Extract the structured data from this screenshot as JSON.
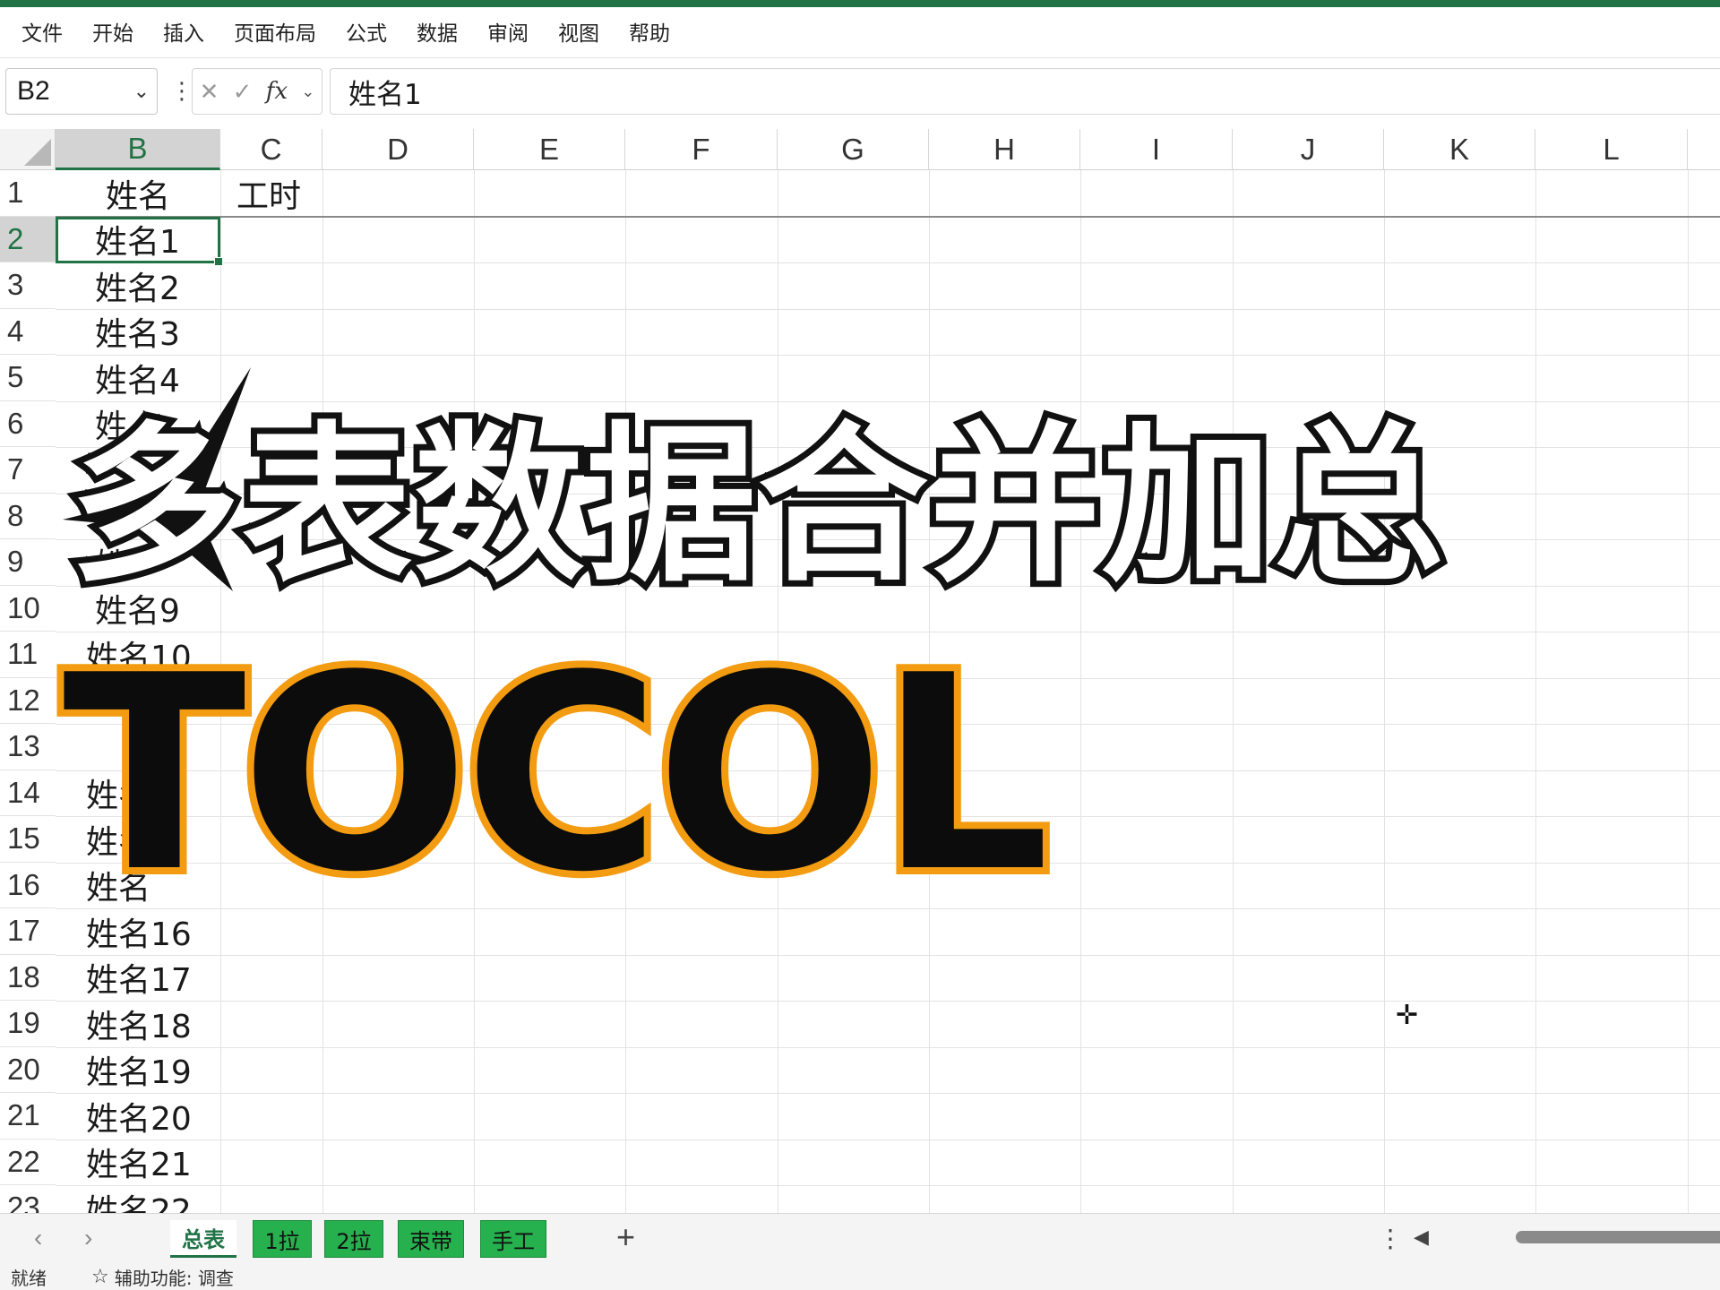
{
  "menu": [
    "文件",
    "开始",
    "插入",
    "页面布局",
    "公式",
    "数据",
    "审阅",
    "视图",
    "帮助"
  ],
  "formula_bar": {
    "name_box": "B2",
    "value": "姓名1",
    "fx_label": "fx"
  },
  "columns": [
    "B",
    "C",
    "D",
    "E",
    "F",
    "G",
    "H",
    "I",
    "J",
    "K",
    "L"
  ],
  "rows": [
    "1",
    "2",
    "3",
    "4",
    "5",
    "6",
    "7",
    "8",
    "9",
    "10",
    "11",
    "12",
    "13",
    "14",
    "15",
    "16",
    "17",
    "18",
    "19",
    "20",
    "21",
    "22",
    "23"
  ],
  "cells": {
    "B1": "姓名",
    "C1": "工时",
    "B2": "姓名1",
    "B3": "姓名2",
    "B4": "姓名3",
    "B5": "姓名4",
    "B10": "姓名9",
    "B17": "姓名16",
    "B18": "姓名17",
    "B19": "姓名18",
    "B20": "姓名19",
    "B21": "姓名20",
    "B22": "姓名21",
    "B23": "姓名22",
    "B6p": "姓",
    "B9p": "姓",
    "B11p": "姓名10",
    "B14p": "姓名",
    "B15p": "姓名",
    "B16p": "姓名"
  },
  "overlay": {
    "headline": "多表数据合并加总",
    "function_name": "TOCOL",
    "headline_color": "#ffffff",
    "function_color": "#0c0c0c",
    "function_outline": "#f39c12"
  },
  "sheet_tabs": [
    {
      "label": "总表",
      "active": true
    },
    {
      "label": "1拉",
      "active": false
    },
    {
      "label": "2拉",
      "active": false
    },
    {
      "label": "束带",
      "active": false
    },
    {
      "label": "手工",
      "active": false
    }
  ],
  "status": {
    "ready": "就绪",
    "accessibility": "辅助功能: 调查"
  },
  "colors": {
    "accent": "#217346",
    "tab_green": "#27b04e"
  }
}
